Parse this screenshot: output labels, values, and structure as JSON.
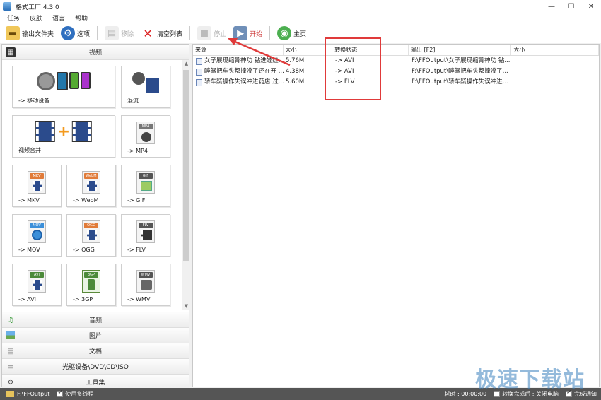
{
  "window": {
    "title": "格式工厂 4.3.0",
    "min": "—",
    "max": "☐",
    "close": "✕"
  },
  "menu": [
    "任务",
    "皮肤",
    "语言",
    "帮助"
  ],
  "toolbar": {
    "output_folder": "输出文件夹",
    "options": "选项",
    "remove": "移除",
    "clear_list": "清空列表",
    "stop": "停止",
    "start": "开始",
    "home": "主页"
  },
  "left": {
    "video_section": "视频",
    "tiles": [
      {
        "label": "-> 移动设备"
      },
      {
        "label": "混流"
      },
      {
        "label": "视频合并"
      },
      {
        "label": "-> MP4",
        "tag": "MP4"
      },
      {
        "label": "-> MKV",
        "tag": "MKV"
      },
      {
        "label": "-> WebM",
        "tag": "WebM"
      },
      {
        "label": "-> GIF",
        "tag": "GIF"
      },
      {
        "label": "-> MOV",
        "tag": "MOV"
      },
      {
        "label": "-> OGG",
        "tag": "OGG"
      },
      {
        "label": "-> FLV",
        "tag": "FLV"
      },
      {
        "label": "-> AVI",
        "tag": "AVI"
      },
      {
        "label": "-> 3GP",
        "tag": "3GP"
      },
      {
        "label": "-> WMV",
        "tag": "WMV"
      }
    ],
    "categories": [
      "音频",
      "图片",
      "文档",
      "光驱设备\\DVD\\CD\\ISO",
      "工具集"
    ]
  },
  "table": {
    "headers": [
      "来源",
      "大小",
      "转换状态",
      "输出 [F2]",
      "大小"
    ],
    "rows": [
      {
        "source": "女子展现缩骨神功 钻进娃娃...",
        "size": "5.76M",
        "status": "-> AVI",
        "output": "F:\\FFOutput\\女子展现缩骨神功 钻..."
      },
      {
        "source": "醉驾把车头都撞没了还在开 ...",
        "size": "4.38M",
        "status": "-> AVI",
        "output": "F:\\FFOutput\\醉驾把车头都撞没了..."
      },
      {
        "source": "轿车疑操作失误冲进药店 过...",
        "size": "5.60M",
        "status": "-> FLV",
        "output": "F:\\FFOutput\\轿车疑操作失误冲进..."
      }
    ]
  },
  "status": {
    "output_path": "F:\\FFOutput",
    "multithread": "使用多线程",
    "elapsed": "耗时 : 00:00:00",
    "after_convert": "转换完成后 : 关闭电脑",
    "notify": "完成通知"
  },
  "watermark": "极速下载站",
  "colors": {
    "accent_red": "#e03a3a",
    "status_bar": "#555555"
  }
}
